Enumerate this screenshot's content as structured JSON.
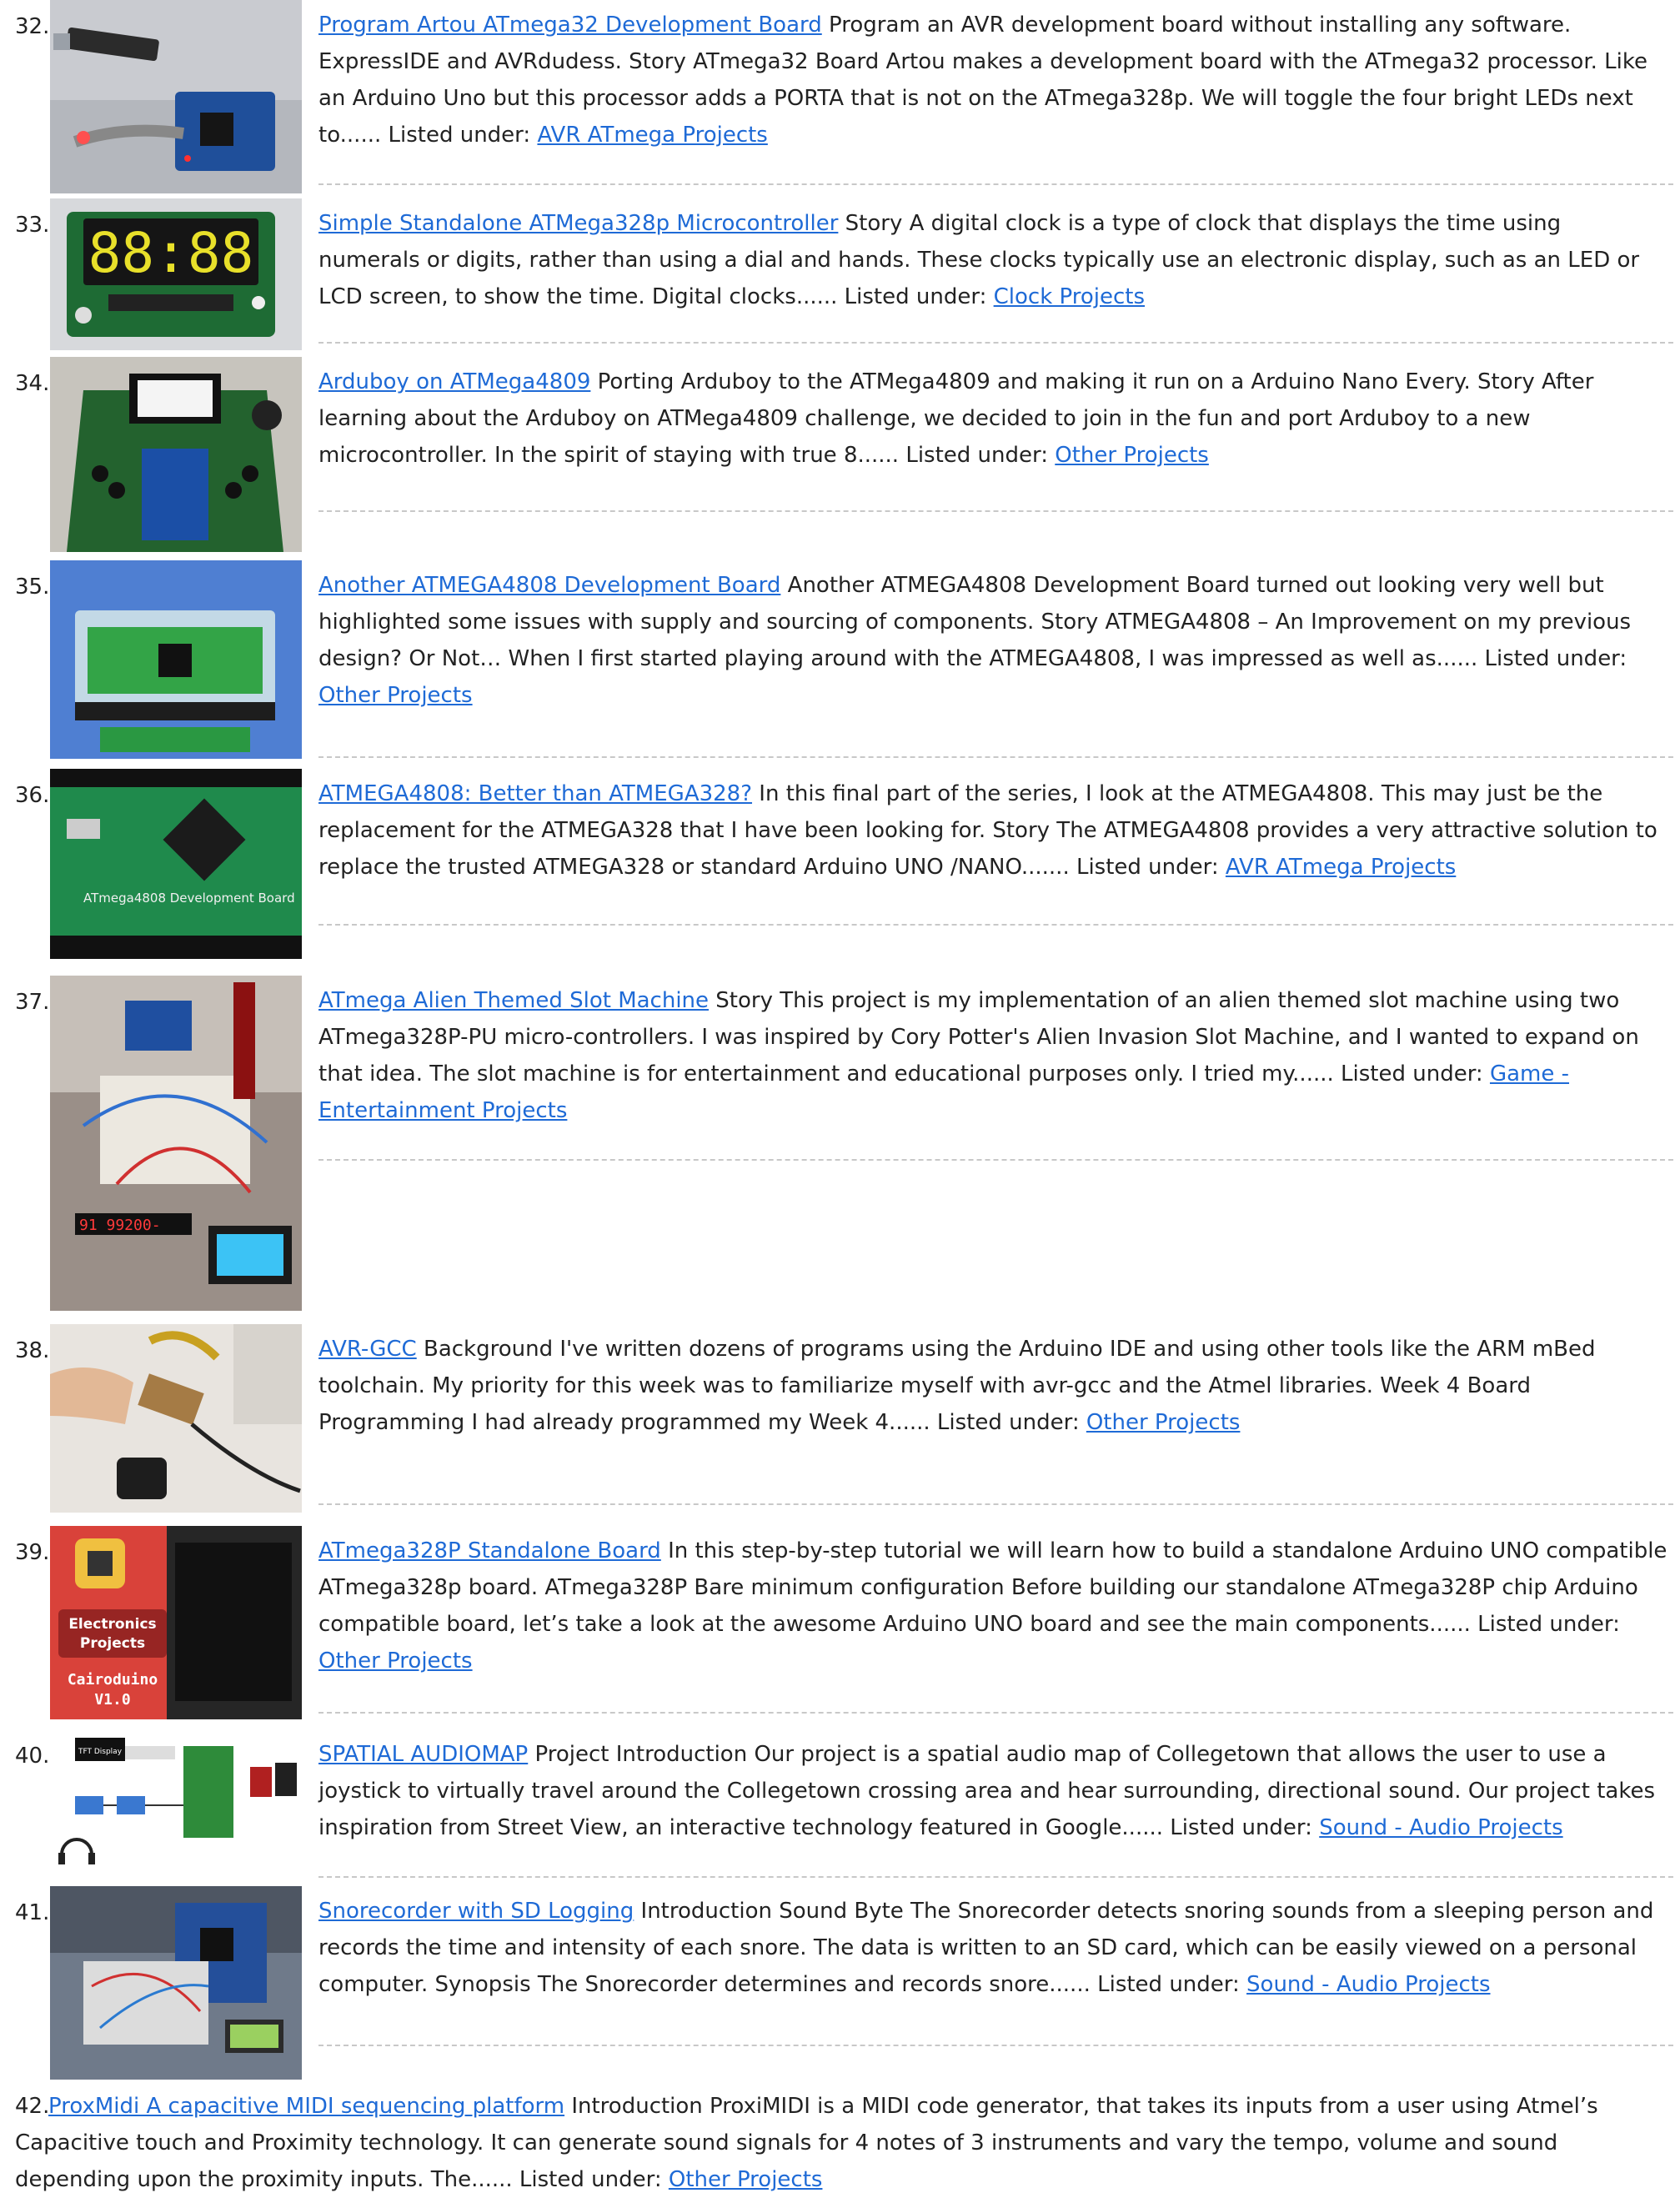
{
  "items": [
    {
      "number": "32.",
      "title": "Program Artou ATmega32 Development Board",
      "summary": " Program an AVR development board without installing any software. ExpressIDE and AVRdudess. Story ATmega32 Board Artou makes a development board with the ATmega32 processor. Like an Arduino Uno but this processor adds a PORTA that is not on the ATmega328p. We will toggle the four bright LEDs next to...... Listed under: ",
      "category": "AVR ATmega Projects",
      "image_icon": "usb-programmer-photo"
    },
    {
      "number": "33.",
      "title": "Simple Standalone ATMega328p Microcontroller",
      "summary": "   Story A digital clock is a type of clock that displays the time using numerals or digits, rather than using a dial and hands. These clocks typically use an electronic display, such as an LED or LCD screen, to show the time. Digital clocks...... Listed under: ",
      "category": "Clock Projects",
      "image_icon": "led-clock-photo",
      "image_text": "88:88"
    },
    {
      "number": "34.",
      "title": "Arduboy on ATMega4809",
      "summary": " Porting Arduboy to the ATMega4809 and making it run on a Arduino Nano Every. Story After learning about the Arduboy on ATMega4809 challenge, we decided to join in the fun and port Arduboy to a new microcontroller. In the spirit of staying with true 8...... Listed under: ",
      "category": "Other Projects",
      "image_icon": "arduboy-photo"
    },
    {
      "number": "35.",
      "title": "Another ATMEGA4808 Development Board",
      "summary": " Another ATMEGA4808 Development Board turned out looking very well but highlighted some issues with supply and sourcing of components. Story ATMEGA4808 – An Improvement on my previous design? Or Not… When I first started playing around with the ATMEGA4808, I was impressed as well as...... Listed under: ",
      "category": "Other Projects",
      "image_icon": "dev-board-stack-photo"
    },
    {
      "number": "36.",
      "title": "ATMEGA4808: Better than ATMEGA328?",
      "summary": " In this final part of the series, I look at the ATMEGA4808. This may just be the replacement for the ATMEGA328 that I have been looking for. Story The ATMEGA4808 provides a very attractive solution to replace the trusted ATMEGA328 or standard Arduino UNO /NANO....... Listed under: ",
      "category": "AVR ATmega Projects",
      "image_icon": "green-pcb-photo",
      "image_text": "ATmega4808 Development Board"
    },
    {
      "number": "37.",
      "title": "ATmega Alien Themed Slot Machine",
      "summary": " Story This project is my implementation of an alien themed slot machine using two ATmega328P-PU micro-controllers. I was inspired by Cory Potter's Alien Invasion Slot Machine, and I wanted to expand on that idea. The slot machine is for entertainment and educational purposes only. I tried my...... Listed under: ",
      "category": "Game - Entertainment Projects",
      "image_icon": "breadboard-slot-machine-photo",
      "image_text": "91 99200-"
    },
    {
      "number": "38.",
      "title": "AVR-GCC",
      "summary": " Background I've written dozens of programs using the Arduino IDE and using other tools like the ARM mBed toolchain. My priority for this week was to familiarize myself with avr-gcc and the Atmel libraries. Week 4 Board Programming I had already programmed my Week 4...... Listed under: ",
      "category": "Other Projects",
      "image_icon": "hand-held-board-photo"
    },
    {
      "number": "39.",
      "title": "ATmega328P Standalone Board",
      "summary": " In this step-by-step tutorial we will learn how to build a standalone Arduino UNO compatible ATmega328p board. ATmega328P Bare minimum configuration Before building our standalone ATmega328P chip Arduino compatible board, let’s take a look at the awesome Arduino UNO board and see the main components...... Listed under: ",
      "category": "Other Projects",
      "image_icon": "cairoduino-cover-photo",
      "image_text_1": "Electronics",
      "image_text_2": "Projects",
      "image_text_3": "Cairoduino",
      "image_text_4": "V1.0"
    },
    {
      "number": "40.",
      "title": "SPATIAL AUDIOMAP",
      "summary": " Project Introduction Our project is a spatial audio map of Collegetown that allows the user to use a joystick to virtually travel around the Collegetown crossing area and hear surrounding, directional sound. Our project takes inspiration from Street View, an interactive technology featured in Google...... Listed under: ",
      "category": "Sound - Audio Projects",
      "image_icon": "block-diagram-image",
      "image_text": "TFT Display"
    },
    {
      "number": "41.",
      "title": "Snorecorder with SD Logging",
      "summary": " Introduction Sound Byte The Snorecorder detects snoring sounds from a sleeping person and records the time and intensity of each snore. The data is written to an SD card, which can be easily viewed on a personal computer. Synopsis The Snorecorder determines and records snore...... Listed under: ",
      "category": "Sound - Audio Projects",
      "image_icon": "snorecorder-photo"
    },
    {
      "number": "42.",
      "title": "ProxMidi A capacitive MIDI sequencing platform",
      "summary": " Introduction ProxiMIDI is a MIDI code generator, that takes its inputs from a user using Atmel’s Capacitive touch and Proximity technology. It can generate sound signals for 4 notes of 3 instruments and vary the tempo, volume and sound depending upon the proximity inputs. The...... Listed under: ",
      "category": "Other Projects"
    }
  ],
  "colors": {
    "link": "#1e6ad6",
    "separator": "#c8c8c8",
    "text": "#222222"
  }
}
